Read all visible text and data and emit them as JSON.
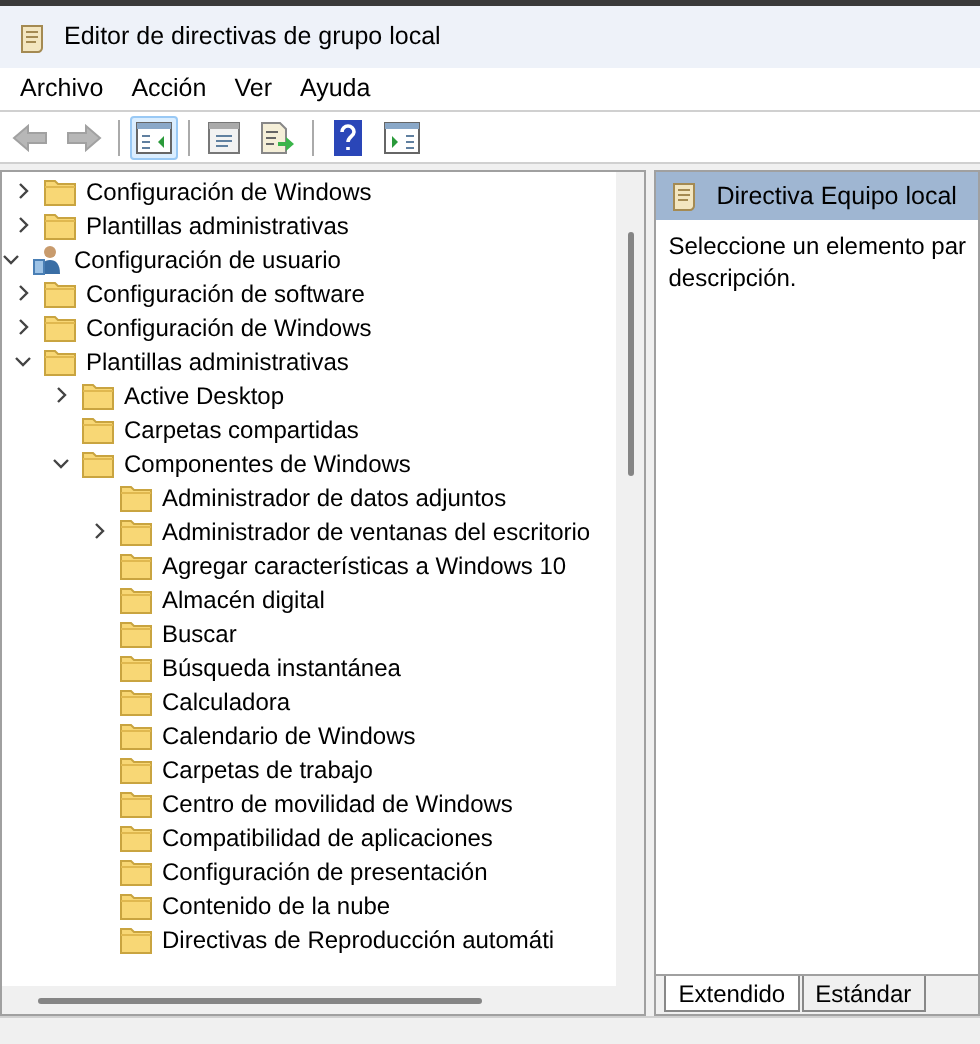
{
  "window": {
    "title": "Editor de directivas de grupo local"
  },
  "menu": [
    "Archivo",
    "Acción",
    "Ver",
    "Ayuda"
  ],
  "toolbar": [
    {
      "kind": "back",
      "disabled": true
    },
    {
      "kind": "forward",
      "disabled": true
    },
    {
      "kind": "sep"
    },
    {
      "kind": "tree",
      "selected": true
    },
    {
      "kind": "sep"
    },
    {
      "kind": "properties",
      "selected": false
    },
    {
      "kind": "export",
      "selected": false
    },
    {
      "kind": "sep"
    },
    {
      "kind": "help",
      "selected": false
    },
    {
      "kind": "pane",
      "selected": false
    }
  ],
  "tree": [
    {
      "children": [
        {
          "label": "Configuración de Windows",
          "kind": "folder",
          "expanded": false
        },
        {
          "label": "Plantillas administrativas",
          "kind": "folder",
          "expanded": false
        }
      ]
    },
    {
      "label": "Configuración de usuario",
      "kind": "user",
      "expanded": true,
      "children": [
        {
          "label": "Configuración de software",
          "kind": "folder",
          "expanded": false
        },
        {
          "label": "Configuración de Windows",
          "kind": "folder",
          "expanded": false
        },
        {
          "label": "Plantillas administrativas",
          "kind": "folder",
          "expanded": true,
          "children": [
            {
              "label": "Active Desktop",
              "kind": "folder",
              "expanded": false
            },
            {
              "label": "Carpetas compartidas",
              "kind": "folder"
            },
            {
              "label": "Componentes de Windows",
              "kind": "folder",
              "expanded": true,
              "children": [
                {
                  "label": "Administrador de datos adjuntos",
                  "kind": "folder"
                },
                {
                  "label": "Administrador de ventanas del escritorio",
                  "kind": "folder",
                  "expanded": false
                },
                {
                  "label": "Agregar características a Windows 10",
                  "kind": "folder"
                },
                {
                  "label": "Almacén digital",
                  "kind": "folder"
                },
                {
                  "label": "Buscar",
                  "kind": "folder"
                },
                {
                  "label": "Búsqueda instantánea",
                  "kind": "folder"
                },
                {
                  "label": "Calculadora",
                  "kind": "folder"
                },
                {
                  "label": "Calendario de Windows",
                  "kind": "folder"
                },
                {
                  "label": "Carpetas de trabajo",
                  "kind": "folder"
                },
                {
                  "label": "Centro de movilidad de Windows",
                  "kind": "folder"
                },
                {
                  "label": "Compatibilidad de aplicaciones",
                  "kind": "folder"
                },
                {
                  "label": "Configuración de presentación",
                  "kind": "folder"
                },
                {
                  "label": "Contenido de la nube",
                  "kind": "folder"
                },
                {
                  "label": "Directivas de Reproducción automáti",
                  "kind": "folder"
                }
              ]
            }
          ]
        }
      ]
    }
  ],
  "details": {
    "header": "Directiva Equipo local",
    "lines": [
      "Seleccione un elemento par",
      "descripción."
    ]
  },
  "tabs": [
    {
      "label": "Extendido",
      "selected": true
    },
    {
      "label": "Estándar",
      "selected": false
    }
  ]
}
